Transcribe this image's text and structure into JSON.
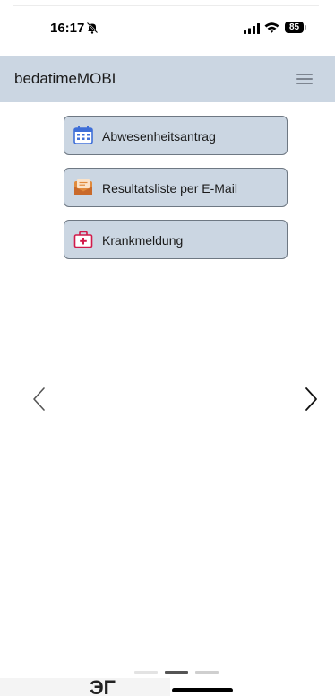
{
  "status_bar": {
    "time": "16:17",
    "icons": [
      "bell-slash-icon",
      "cellular-signal-icon",
      "wifi-icon"
    ],
    "battery_level": "85"
  },
  "header": {
    "title": "bedatimeMOBI",
    "menu_icon": "hamburger-menu-icon"
  },
  "actions": [
    {
      "label": "Abwesenheitsantrag",
      "icon": "calendar-icon",
      "icon_color": "#3f6fd8"
    },
    {
      "label": "Resultatsliste per E-Mail",
      "icon": "email-envelope-icon",
      "icon_color": "#e08a3c"
    },
    {
      "label": "Krankmeldung",
      "icon": "medical-kit-icon",
      "icon_color": "#d11a4a"
    }
  ],
  "carousel": {
    "prev_icon": "chevron-left-icon",
    "next_icon": "chevron-right-icon",
    "slide_count": 3,
    "active_slide": 2
  },
  "bottom": {
    "glyph_text": "ЭΓ"
  },
  "colors": {
    "header_bg": "#cbd6e2",
    "button_bg": "#cbd6e2",
    "button_border": "#6e7883"
  }
}
